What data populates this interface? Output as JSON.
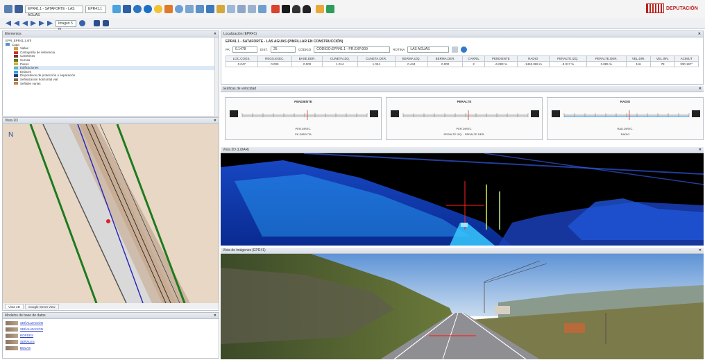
{
  "toolbar": {
    "combo_road": "EPR41.1 - SATAFORTE - LAS AGUAS",
    "combo_mode": "EPR41.1",
    "zoom_combo": "Imagen 5 m"
  },
  "logo": {
    "text": "DEPUTACIÓN"
  },
  "panels": {
    "layers_title": "Elementos",
    "map_title": "Vista 2D",
    "db_title": "Modelos de base de datos",
    "location_title": "Localización (EPR41)",
    "graphs_title": "Gráficas de velocidad",
    "pointcloud_title": "Vista 3D (LiDAR)",
    "photo_title": "Vista de imágenes (EPR41)"
  },
  "layers": {
    "root": "EPR_EPR41.1.shf",
    "group": "Capa",
    "items": [
      "Vallas",
      "Cartografía de referencia",
      "Carreteras",
      "Curvas",
      "Pasos",
      "Edificaciones",
      "Enlaces",
      "Dispositivos de protección o separación",
      "Señalización horizontal vial",
      "Señales varias"
    ],
    "colors": [
      "#cfa03a",
      "#c0392b",
      "#8b2a2a",
      "#4a7f2b",
      "#e0b020",
      "#55b8d8",
      "#2ea0d8",
      "#2a3a70",
      "#6a6a6a",
      "#d08030"
    ]
  },
  "location": {
    "header": "EPR41.1 - SATAFORTE - LAS AGUAS (PINFILLAR EN CONSTRUCCIÓN)",
    "pk_label": "PK",
    "pk_value": "0.1478",
    "dist_label": "DIST.",
    "dist_value": "25",
    "code_label": "CÓDIGO",
    "code_value": "CÓDIGO:EPR41.1 - PR.EXP.009",
    "route_label": "ROTINA",
    "route_value": "LAS AGUAS",
    "table": {
      "headers": [
        "LOC.COGS.",
        "REGS.EXEC.",
        "BASE.DER.",
        "CUNETA.IZQ.",
        "CUNETA.DER.",
        "BERMA.IZQ.",
        "BERMA.DER.",
        "CARRIL",
        "PENDIENTE",
        "RADIO",
        "PERALTE.IZQ.",
        "PERALTE.DER.",
        "VEL.DIR.",
        "VEL.INV.",
        "ACIMUT"
      ],
      "values": [
        "0.047",
        "0.000",
        "0.000",
        "1.014",
        "1.024",
        "0.444",
        "0.000",
        "2",
        "-6.083 %",
        "-1462.088 m",
        "-3.017 %",
        "3.085 %",
        "116",
        "78",
        "330.167°"
      ]
    }
  },
  "graphs": [
    {
      "title": "PENDIENTE",
      "footer": "PEN.DIREC.",
      "legend": "PK.DIRECTA"
    },
    {
      "title": "PERALTE",
      "footer": "PER.DIREC.",
      "legend": "PERALTE IZQ. · PERALTE DER."
    },
    {
      "title": "RADIO",
      "footer": "RAD.DIREC.",
      "legend": "RADIO"
    }
  ],
  "map": {
    "tabs": [
      "Vista 2D",
      "Google Street View"
    ],
    "north": "N"
  },
  "db": {
    "items": [
      "SEÑALIZACIÓN",
      "SEÑALIZACIÓN",
      "BORDES",
      "SEÑALES",
      "BOLAS"
    ]
  }
}
